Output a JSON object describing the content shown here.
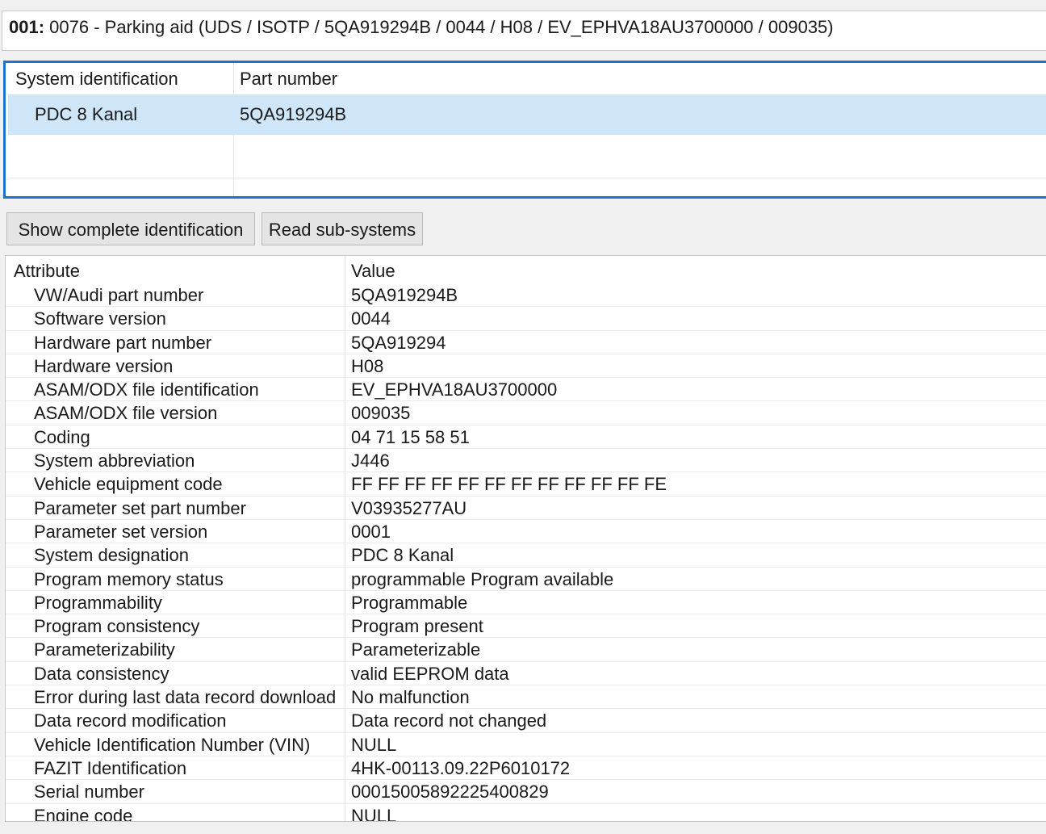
{
  "header": {
    "address": "001:",
    "title": "0076 - Parking aid  (UDS / ISOTP / 5QA919294B / 0044 / H08 / EV_EPHVA18AU3700000 / 009035)"
  },
  "system_table": {
    "columns": [
      "System identification",
      "Part number"
    ],
    "selected_row": {
      "system": "PDC 8 Kanal",
      "part_number": "5QA919294B"
    }
  },
  "buttons": {
    "show_complete": "Show complete identification",
    "read_subsystems": "Read sub-systems"
  },
  "attributes": {
    "columns": [
      "Attribute",
      "Value"
    ],
    "rows": [
      {
        "name": "VW/Audi part number",
        "value": "5QA919294B"
      },
      {
        "name": "Software version",
        "value": "0044"
      },
      {
        "name": "Hardware part number",
        "value": "5QA919294"
      },
      {
        "name": "Hardware version",
        "value": "H08"
      },
      {
        "name": "ASAM/ODX file identification",
        "value": "EV_EPHVA18AU3700000"
      },
      {
        "name": "ASAM/ODX file version",
        "value": "009035"
      },
      {
        "name": "Coding",
        "value": "04 71 15 58 51"
      },
      {
        "name": "System abbreviation",
        "value": "J446"
      },
      {
        "name": "Vehicle equipment code",
        "value": "FF FF FF FF FF FF FF FF FF FF FF FE"
      },
      {
        "name": "Parameter set part number",
        "value": "V03935277AU"
      },
      {
        "name": "Parameter set version",
        "value": "0001"
      },
      {
        "name": "System designation",
        "value": "PDC 8 Kanal"
      },
      {
        "name": "Program memory status",
        "value": "programmable Program available"
      },
      {
        "name": "Programmability",
        "value": "Programmable"
      },
      {
        "name": "Program consistency",
        "value": "Program present"
      },
      {
        "name": "Parameterizability",
        "value": "Parameterizable"
      },
      {
        "name": "Data consistency",
        "value": "valid EEPROM data"
      },
      {
        "name": "Error during last data record download",
        "value": "No malfunction"
      },
      {
        "name": "Data record modification",
        "value": "Data record not changed"
      },
      {
        "name": "Vehicle Identification Number (VIN)",
        "value": "NULL"
      },
      {
        "name": "FAZIT Identification",
        "value": "4HK-00113.09.22P6010172"
      },
      {
        "name": "Serial number",
        "value": "00015005892225400829"
      },
      {
        "name": "Engine code",
        "value": "NULL"
      }
    ]
  }
}
